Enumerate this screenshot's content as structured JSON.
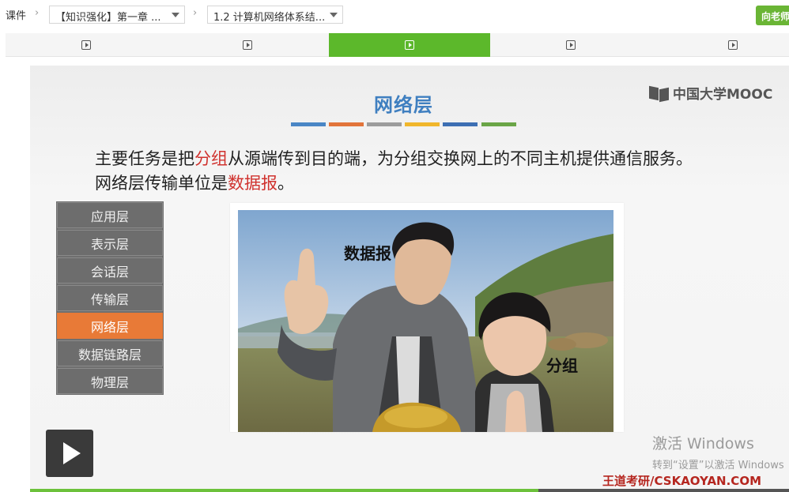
{
  "breadcrumb": {
    "root": "课件",
    "chapter": "【知识强化】第一章 ...",
    "section": "1.2 计算机网络体系结..."
  },
  "ask_button": "向老师",
  "lesson_tabs": [
    {
      "icon": "play-square-icon",
      "active": false
    },
    {
      "icon": "play-square-icon",
      "active": false
    },
    {
      "icon": "play-square-icon",
      "active": true
    },
    {
      "icon": "play-square-icon",
      "active": false
    },
    {
      "icon": "play-square-icon",
      "active": false
    }
  ],
  "slide": {
    "title": "网络层",
    "logo": "中国大学MOOC",
    "bar_colors": [
      "#4a86c5",
      "#e2743a",
      "#9c9c9c",
      "#f0b62c",
      "#3d6fb3",
      "#6aa547"
    ],
    "line1": {
      "a": "主要任务是把",
      "b": "分组",
      "c": "从源端传到目的端，为分组交换网上的不同主机提供通信服务。"
    },
    "line2": {
      "a": "网络层传输单位是",
      "b": "数据报",
      "c": "。"
    },
    "highlight_color": "#d0322e",
    "layers": [
      "应用层",
      "表示层",
      "会话层",
      "传输层",
      "网络层",
      "数据链路层",
      "物理层"
    ],
    "active_layer": "网络层",
    "photo_label_1": "数据报",
    "photo_label_2": "分组"
  },
  "watermark": {
    "line1": "激活 Windows",
    "line2": "转到“设置”以激活 Windows"
  },
  "brand": "王道考研/CSKAOYAN.COM",
  "progress": 0.67
}
